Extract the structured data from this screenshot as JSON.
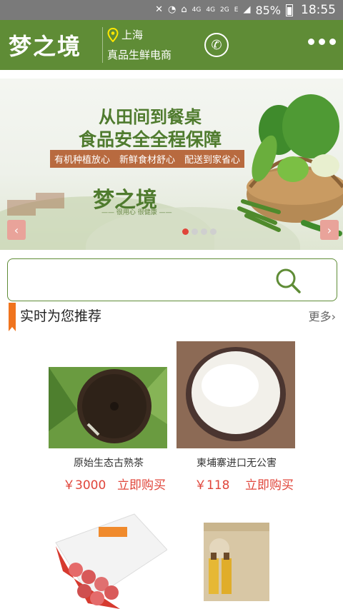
{
  "status_bar": {
    "network": "4G",
    "network2": "4G",
    "network3": "2G",
    "data": "E",
    "battery": "85%",
    "time": "18:55"
  },
  "header": {
    "logo": "梦之境",
    "location": "上海",
    "slogan": "真品生鲜电商"
  },
  "banner": {
    "line1": "从田间到餐桌",
    "line2": "食品安全全程保障",
    "tags": [
      "有机种植放心",
      "新鲜食材舒心",
      "配送到家省心"
    ],
    "logo": "梦之境",
    "logo_sub": "—— 很用心  很健康 ——",
    "dots": 4,
    "active_dot": 0
  },
  "search": {
    "placeholder": "",
    "value": ""
  },
  "section": {
    "title": "实时为您推荐",
    "more": "更多›"
  },
  "products": [
    {
      "name": "原始生态古熟茶",
      "price": "￥3000",
      "buy": "立即购买"
    },
    {
      "name": "柬埔寨进口无公害",
      "price": "￥118",
      "buy": "立即购买"
    },
    {
      "name": "",
      "price": "",
      "buy": ""
    },
    {
      "name": "",
      "price": "",
      "buy": ""
    }
  ],
  "colors": {
    "brand_green": "#5f8c36",
    "accent_red": "#e0453a",
    "flag_orange": "#f0741e"
  }
}
